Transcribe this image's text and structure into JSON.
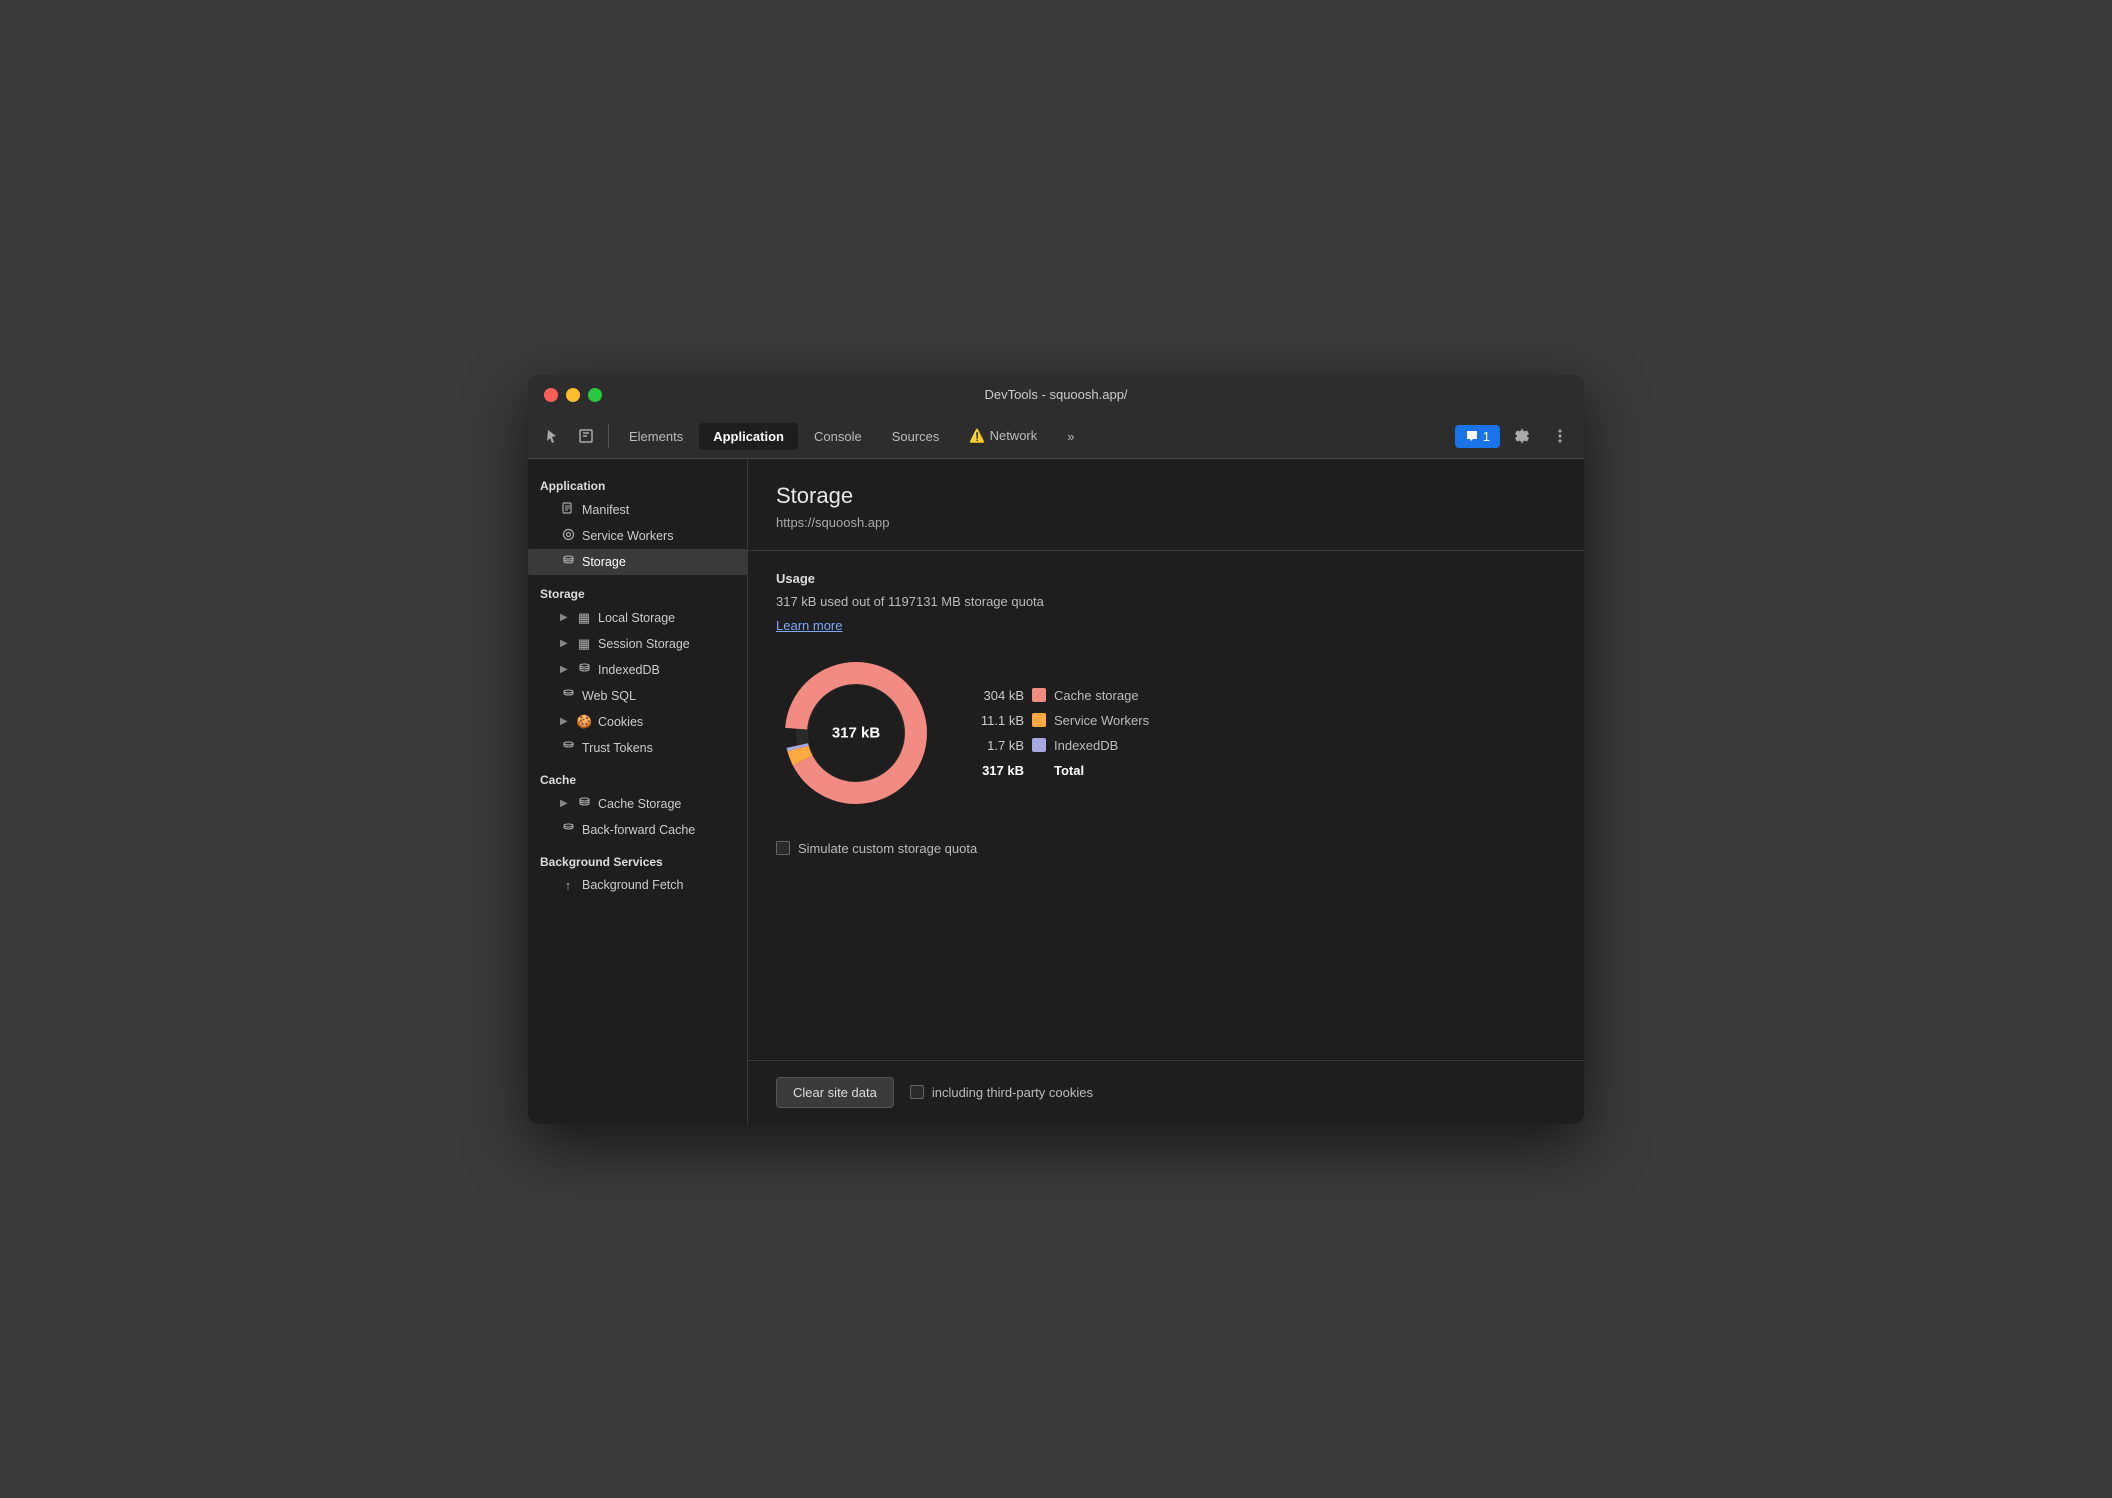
{
  "window": {
    "title": "DevTools - squoosh.app/"
  },
  "toolbar": {
    "tabs": [
      {
        "id": "elements",
        "label": "Elements",
        "active": false,
        "warning": false
      },
      {
        "id": "application",
        "label": "Application",
        "active": true,
        "warning": false
      },
      {
        "id": "console",
        "label": "Console",
        "active": false,
        "warning": false
      },
      {
        "id": "sources",
        "label": "Sources",
        "active": false,
        "warning": false
      },
      {
        "id": "network",
        "label": "Network",
        "active": false,
        "warning": true
      }
    ],
    "badge_count": "1",
    "more_label": "»"
  },
  "sidebar": {
    "sections": [
      {
        "label": "Application",
        "items": [
          {
            "label": "Manifest",
            "icon": "📄",
            "indent": 1,
            "has_chevron": false
          },
          {
            "label": "Service Workers",
            "icon": "⚙",
            "indent": 1,
            "has_chevron": false
          },
          {
            "label": "Storage",
            "icon": "🗄",
            "indent": 1,
            "has_chevron": false,
            "active": true
          }
        ]
      },
      {
        "label": "Storage",
        "items": [
          {
            "label": "Local Storage",
            "icon": "▦",
            "indent": 1,
            "has_chevron": true
          },
          {
            "label": "Session Storage",
            "icon": "▦",
            "indent": 1,
            "has_chevron": true
          },
          {
            "label": "IndexedDB",
            "icon": "🗄",
            "indent": 1,
            "has_chevron": true
          },
          {
            "label": "Web SQL",
            "icon": "🗄",
            "indent": 1,
            "has_chevron": false
          },
          {
            "label": "Cookies",
            "icon": "🍪",
            "indent": 1,
            "has_chevron": true
          },
          {
            "label": "Trust Tokens",
            "icon": "🗄",
            "indent": 1,
            "has_chevron": false
          }
        ]
      },
      {
        "label": "Cache",
        "items": [
          {
            "label": "Cache Storage",
            "icon": "🗄",
            "indent": 1,
            "has_chevron": true
          },
          {
            "label": "Back-forward Cache",
            "icon": "🗄",
            "indent": 1,
            "has_chevron": false
          }
        ]
      },
      {
        "label": "Background Services",
        "items": [
          {
            "label": "Background Fetch",
            "icon": "↑",
            "indent": 1,
            "has_chevron": false
          }
        ]
      }
    ]
  },
  "content": {
    "title": "Storage",
    "url": "https://squoosh.app",
    "usage_label": "Usage",
    "usage_text": "317 kB used out of 1197131 MB storage quota",
    "learn_more": "Learn more",
    "donut_center": "317 kB",
    "legend": [
      {
        "value": "304 kB",
        "label": "Cache storage",
        "color": "#f28b82"
      },
      {
        "value": "11.1 kB",
        "label": "Service Workers",
        "color": "#ffa940"
      },
      {
        "value": "1.7 kB",
        "label": "IndexedDB",
        "color": "#aaa8e0"
      },
      {
        "value": "317 kB",
        "label": "Total",
        "color": null,
        "is_total": true
      }
    ],
    "simulate_label": "Simulate custom storage quota",
    "clear_btn": "Clear site data",
    "third_party_label": "including third-party cookies"
  },
  "colors": {
    "cache": "#f28b82",
    "workers": "#ffa940",
    "indexed": "#aaa8e0",
    "donut_bg": "#2a2a2a"
  }
}
